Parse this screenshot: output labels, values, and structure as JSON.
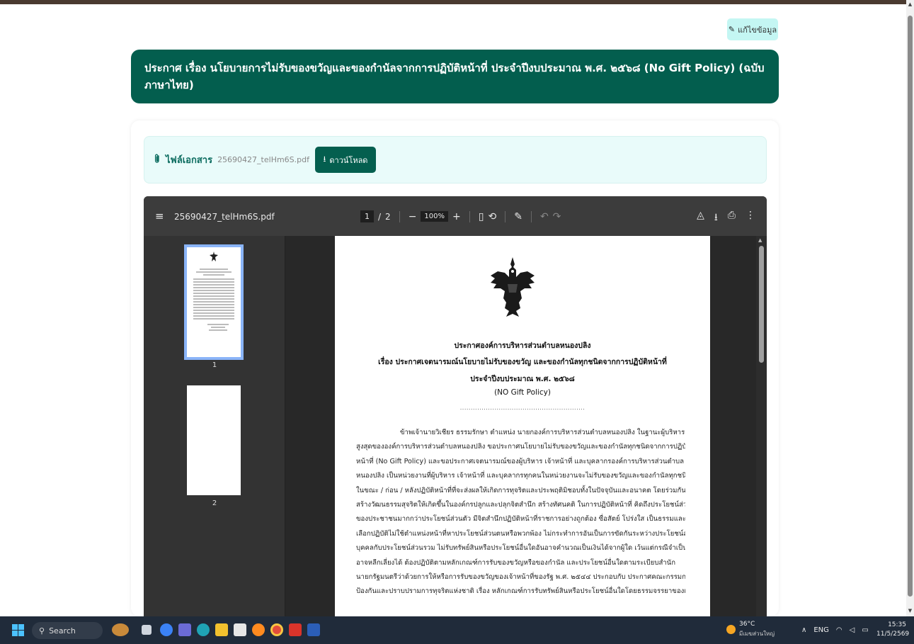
{
  "page": {
    "edit_label": "แก้ไขข้อมูล",
    "title": "ประกาศ เรื่อง นโยบายการไม่รับของขวัญและของกำนัลจากการปฏิบัติหน้าที่ ประจำปีงบประมาณ พ.ศ. ๒๕๖๘ (No Gift Policy) (ฉบับภาษาไทย)",
    "attachment_label": "ไฟล์เอกสาร",
    "attachment_filename": "25690427_telHm6S.pdf",
    "download_label": "ดาวน์โหลด"
  },
  "viewer": {
    "filename": "25690427_telHm6S.pdf",
    "current_page": "1",
    "page_separator": "/",
    "total_pages": "2",
    "zoom": "100%",
    "thumbnails": [
      "1",
      "2"
    ]
  },
  "document": {
    "heading1": "ประกาศองค์การบริหารส่วนตำบลหนองปลิง",
    "heading2": "เรื่อง  ประกาศเจตนารมณ์นโยบายไม่รับของขวัญ และของกำนัลทุกชนิดจากการปฏิบัติหน้าที่",
    "heading3": "ประจำปีงบประมาณ พ.ศ. ๒๕๖๘",
    "heading4": "(NO Gift Policy)",
    "dots": "..........................................................",
    "body_lines": [
      "ข้าพเจ้านายวิเชียร ธรรมรักษา ตำแหน่ง นายกองค์การบริหารส่วนตำบลหนองปลิง ในฐานะผู้บริหาร",
      "สูงสุดขององค์การบริหารส่วนตำบลหนองปลิง ขอประกาศนโยบายไม่รับของขวัญและของกำนัลทุกชนิดจากการปฏิบัติ",
      "หน้าที่ (No Gift Policy) และขอประกาศเจตนารมณ์ของผู้บริหาร เจ้าหน้าที่ และบุคลากรองค์การบริหารส่วนตำบล",
      "หนองปลิง เป็นหน่วยงานที่ผู้บริหาร เจ้าหน้าที่ และบุคลากรทุกคนในหน่วยงานจะไม่รับของขวัญและของกำนัลทุกชนิด",
      "ในขณะ / ก่อน / หลังปฏิบัติหน้าที่ที่จะส่งผลให้เกิดการทุจริตและประพฤติมิชอบทั้งในปัจจุบันและอนาคต โดยร่วมกัน",
      "สร้างวัฒนธรรมสุจริตให้เกิดขึ้นในองค์กรปลูกและปลุกจิตสำนึก สร้างทัศนคติ ในการปฏิบัติหน้าที่ คิดถึงประโยชน์ส่วนรวม",
      "ของประชาชนมากกว่าประโยชน์ส่วนตัว มีจิตสำนึกปฏิบัติหน้าที่ราชการอย่างถูกต้อง ซื่อสัตย์ โปร่งใส เป็นธรรมและไม่",
      "เลือกปฏิบัติไม่ใช้ตำแหน่งหน้าที่หาประโยชน์ส่วนตนหรือพวกพ้อง ไม่กระทำการอันเป็นการขัดกันระหว่างประโยชน์ส่วน",
      "บุคคลกับประโยชน์ส่วนรวม ไม่รับทรัพย์สินหรือประโยชน์อื่นใดอันอาจคำนวณเป็นเงินได้จากผู้ใด เว้นแต่กรณีจำเป็นไม่",
      "อาจหลีกเลี่ยงได้ ต้องปฏิบัติตามหลักเกณฑ์การรับของขวัญหรือของกำนัล และประโยชน์อื่นใดตามระเบียบสำนัก",
      "นายกรัฐมนตรีว่าด้วยการให้หรือการรับของขวัญของเจ้าหน้าที่ของรัฐ พ.ศ. ๒๕๔๔ ประกอบกับ ประกาศคณะกรรมการ",
      "ป้องกันและปราบปรามการทุจริตแห่งชาติ เรื่อง หลักเกณฑ์การรับทรัพย์สินหรือประโยชน์อื่นใดโดยธรรมจรรยาของเจ้า"
    ]
  },
  "taskbar": {
    "search_label": "Search",
    "temperature": "36°C",
    "weather_desc": "มีเมฆส่วนใหญ่",
    "language": "ENG",
    "time": "15:35",
    "date": "11/5/2569"
  },
  "colors": {
    "banner": "#035e4e",
    "attach_bg": "#e9fbfa",
    "edit_bg": "#c4f6f3",
    "taskbar": "#202b3a"
  }
}
